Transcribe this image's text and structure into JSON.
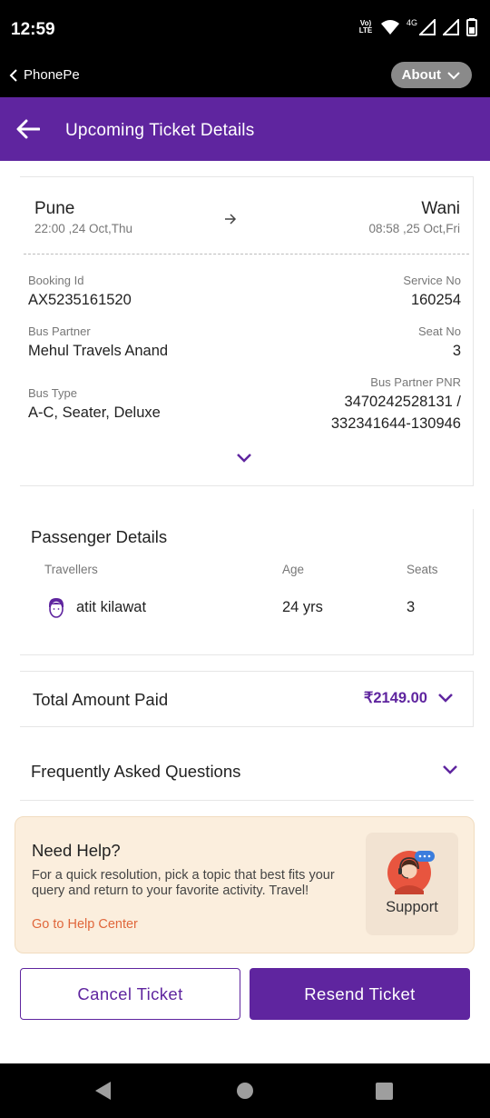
{
  "status_bar": {
    "time": "12:59",
    "volte_label": "Vo) LTE",
    "network_label": "4G",
    "icons": [
      "volte-icon",
      "wifi-icon",
      "signal-icon",
      "signal-icon",
      "battery-icon"
    ]
  },
  "app_bar": {
    "back_label": "PhonePe",
    "about_label": "About"
  },
  "header": {
    "title": "Upcoming Ticket Details"
  },
  "journey": {
    "from_city": "Pune",
    "from_time": "22:00 ,24 Oct,Thu",
    "to_city": "Wani",
    "to_time": "08:58 ,25 Oct,Fri",
    "booking_id_label": "Booking Id",
    "booking_id": "AX5235161520",
    "service_no_label": "Service No",
    "service_no": "160254",
    "bus_partner_label": "Bus Partner",
    "bus_partner": "Mehul Travels Anand",
    "seat_no_label": "Seat No",
    "seat_no": "3",
    "bus_type_label": "Bus Type",
    "bus_type": "A-C, Seater, Deluxe",
    "pnr_label": "Bus Partner PNR",
    "pnr_line1": "3470242528131 /",
    "pnr_line2": "332341644-130946"
  },
  "passengers": {
    "title": "Passenger Details",
    "col_travellers": "Travellers",
    "col_age": "Age",
    "col_seats": "Seats",
    "rows": [
      {
        "name": "atit kilawat",
        "age": "24 yrs",
        "seat": "3"
      }
    ]
  },
  "amount": {
    "label": "Total Amount Paid",
    "value": "₹2149.00"
  },
  "faq": {
    "label": "Frequently Asked Questions"
  },
  "help": {
    "title": "Need Help?",
    "description": "For a quick resolution, pick a topic that best fits your query and return to your favorite activity. Travel!",
    "link": "Go to Help Center",
    "support_label": "Support"
  },
  "actions": {
    "cancel_label": "Cancel Ticket",
    "resend_label": "Resend Ticket"
  },
  "colors": {
    "brand": "#5f259f",
    "link": "#e0673c",
    "help_bg": "#fbeedd"
  }
}
